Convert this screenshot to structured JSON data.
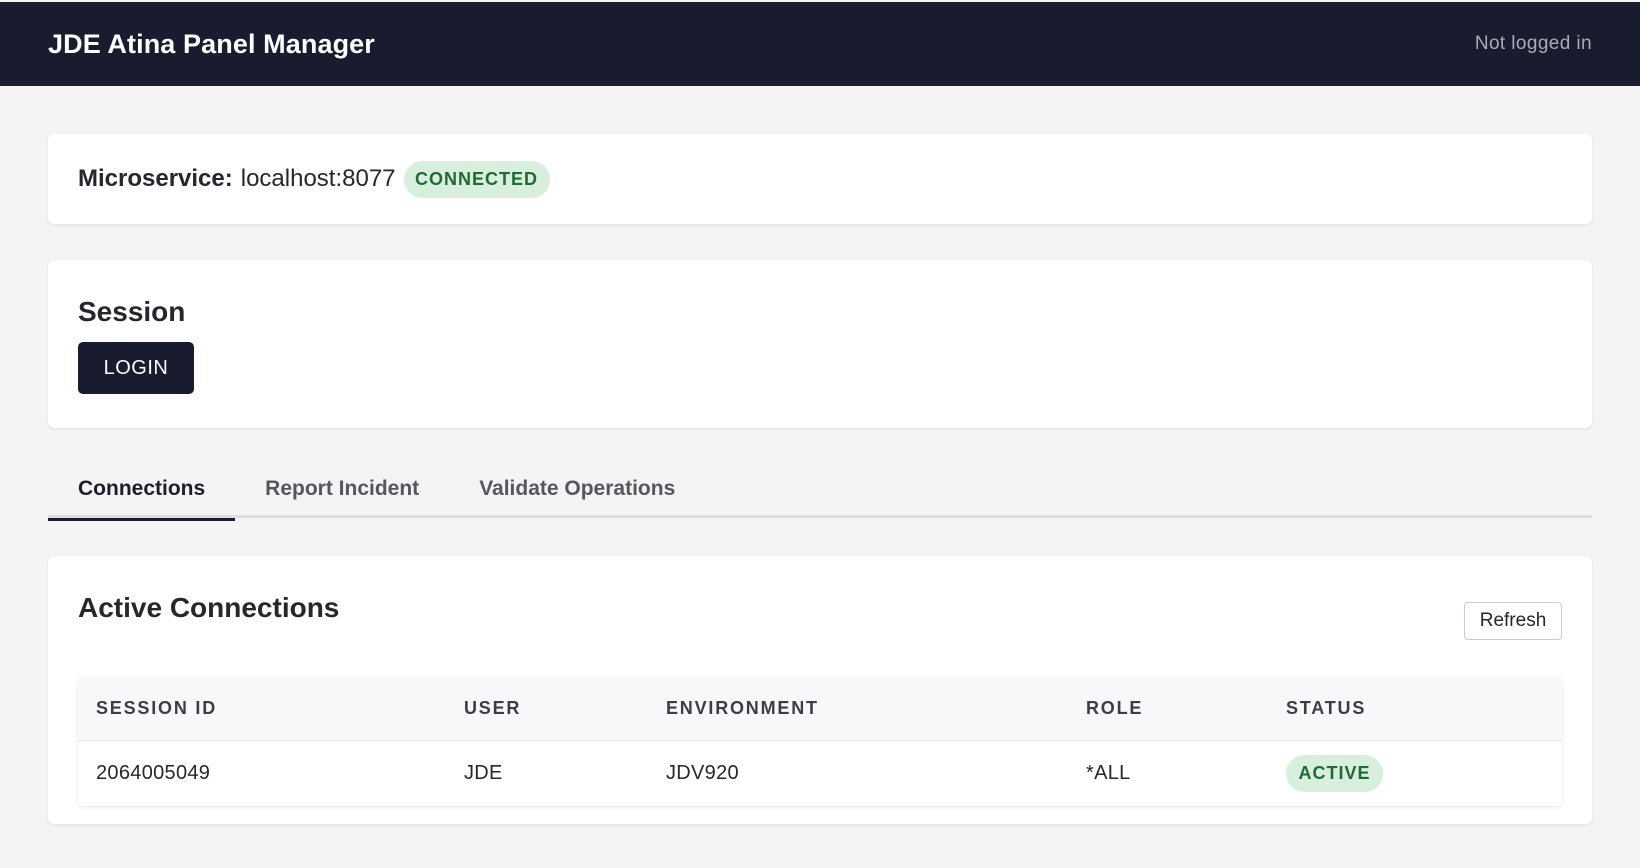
{
  "header": {
    "title": "JDE Atina Panel Manager",
    "login_status": "Not logged in"
  },
  "microservice": {
    "label": "Microservice:",
    "value": "localhost:8077",
    "status": "CONNECTED"
  },
  "session": {
    "title": "Session",
    "login_label": "LOGIN"
  },
  "tabs": [
    {
      "label": "Connections",
      "active": true
    },
    {
      "label": "Report Incident",
      "active": false
    },
    {
      "label": "Validate Operations",
      "active": false
    }
  ],
  "connections": {
    "title": "Active Connections",
    "refresh_label": "Refresh",
    "columns": [
      "SESSION ID",
      "USER",
      "ENVIRONMENT",
      "ROLE",
      "STATUS"
    ],
    "rows": [
      {
        "session_id": "2064005049",
        "user": "JDE",
        "environment": "JDV920",
        "role": "*ALL",
        "status": "ACTIVE"
      }
    ]
  },
  "colors": {
    "header_bg": "#191b2e",
    "badge_bg": "#d9efdd",
    "badge_text": "#1f6b33",
    "page_bg": "#f4f4f5"
  }
}
